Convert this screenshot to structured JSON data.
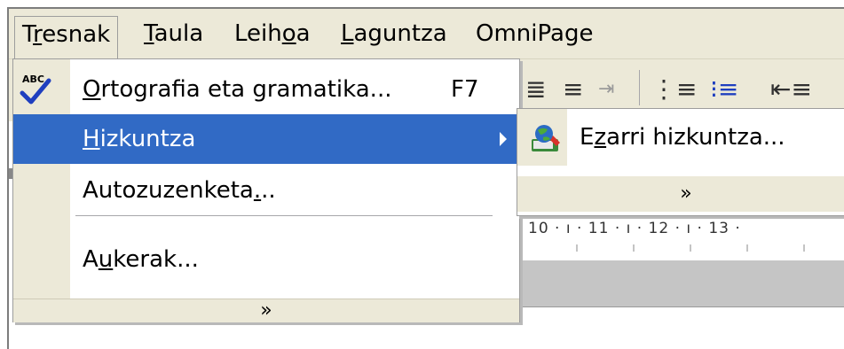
{
  "menubar": {
    "items": [
      {
        "label": "Tresnak",
        "key_index": 1
      },
      {
        "label": "Taula",
        "key_index": 0
      },
      {
        "label": "Leihoa",
        "key_index": 4
      },
      {
        "label": "Laguntza",
        "key_index": 0
      },
      {
        "label": "OmniPage",
        "key_index": -1
      }
    ]
  },
  "tools_menu": {
    "items": [
      {
        "label": "Ortografia eta gramatika...",
        "shortcut": "F7",
        "icon": "spellcheck-abc-icon"
      },
      {
        "label": "Hizkuntza",
        "has_submenu": true,
        "highlighted": true
      },
      {
        "label": "Autozuzenketa..."
      },
      {
        "label": "Aukerak..."
      }
    ],
    "expand_glyph": "»"
  },
  "language_submenu": {
    "items": [
      {
        "label": "Ezarri hizkuntza...",
        "icon": "set-language-globe-icon"
      }
    ],
    "expand_glyph": "»"
  },
  "ruler": {
    "text": "10 · ı · 11 · ı · 12 · ı · 13 ·"
  },
  "colors": {
    "menu_bg": "#ece9d8",
    "highlight": "#316ac5",
    "highlight_text": "#ffffff",
    "border": "#9d9d9d"
  }
}
